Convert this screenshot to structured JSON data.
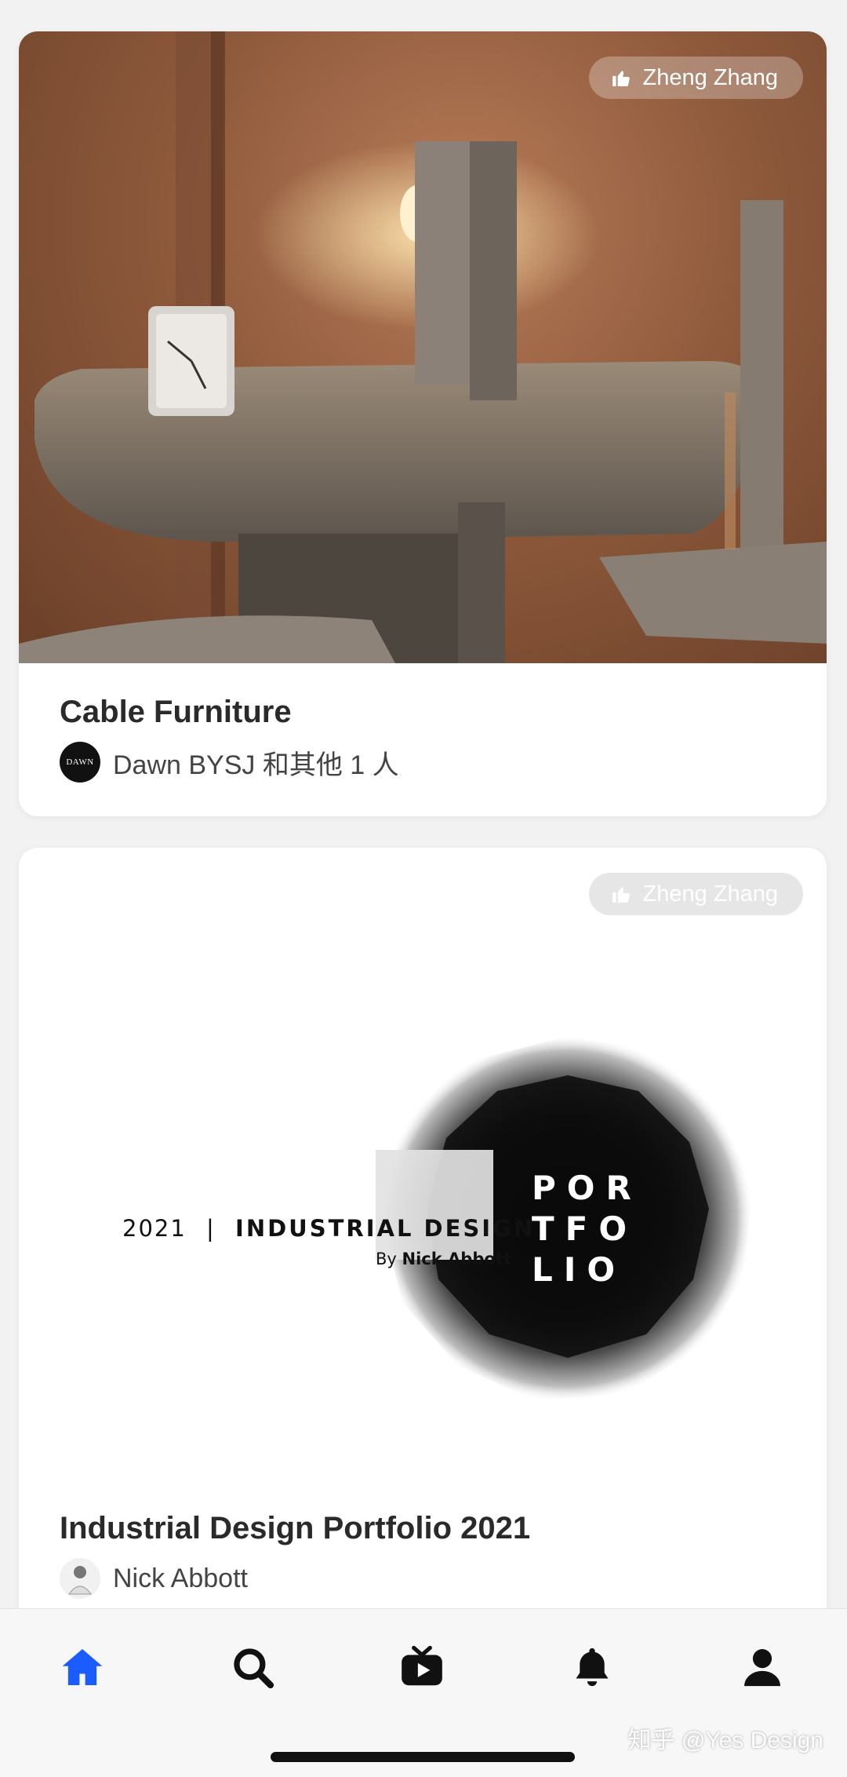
{
  "feed": [
    {
      "liker": "Zheng Zhang",
      "title": "Cable Furniture",
      "author": "Dawn BYSJ 和其他 1 人",
      "avatar_text": "DAWN"
    },
    {
      "liker": "Zheng Zhang",
      "title": "Industrial Design Portfolio 2021",
      "author": "Nick Abbott",
      "cover": {
        "year": "2021",
        "separator": "|",
        "heading": "INDUSTRIAL DESIGN",
        "by_prefix": "By",
        "by_name": "Nick Abbott",
        "word_lines": [
          "POR",
          "TFO",
          "LIO"
        ]
      }
    }
  ],
  "tabbar": {
    "active": "home",
    "active_color": "#1a5cff",
    "icons": [
      "home-icon",
      "search-icon",
      "video-icon",
      "bell-icon",
      "profile-icon"
    ]
  },
  "watermark": "知乎 @Yes Design"
}
